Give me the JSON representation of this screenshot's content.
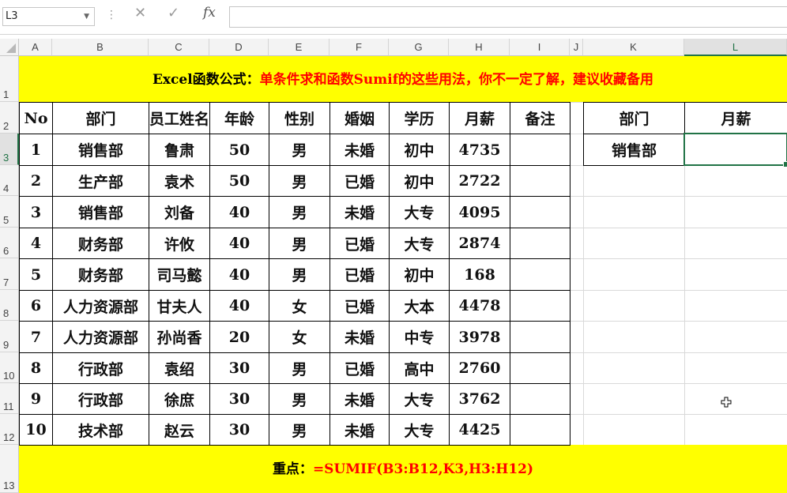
{
  "formula_bar": {
    "name_box": "L3",
    "formula": ""
  },
  "columns": [
    "A",
    "B",
    "C",
    "D",
    "E",
    "F",
    "G",
    "H",
    "I",
    "J",
    "K",
    "L"
  ],
  "rows": [
    "1",
    "2",
    "3",
    "4",
    "5",
    "6",
    "7",
    "8",
    "9",
    "10",
    "11",
    "12",
    "13"
  ],
  "banner_top": {
    "prefix": "Excel函数公式：",
    "main": "单条件求和函数Sumif的这些用法，你不一定了解，建议收藏备用"
  },
  "banner_bottom": {
    "prefix": "重点：",
    "formula": "=SUMIF(B3:B12,K3,H3:H12)"
  },
  "table": {
    "headers": [
      "No",
      "部门",
      "员工姓名",
      "年龄",
      "性别",
      "婚姻",
      "学历",
      "月薪",
      "备注"
    ],
    "rows": [
      [
        "1",
        "销售部",
        "鲁肃",
        "50",
        "男",
        "未婚",
        "初中",
        "4735",
        ""
      ],
      [
        "2",
        "生产部",
        "袁术",
        "50",
        "男",
        "已婚",
        "初中",
        "2722",
        ""
      ],
      [
        "3",
        "销售部",
        "刘备",
        "40",
        "男",
        "未婚",
        "大专",
        "4095",
        ""
      ],
      [
        "4",
        "财务部",
        "许攸",
        "40",
        "男",
        "已婚",
        "大专",
        "2874",
        ""
      ],
      [
        "5",
        "财务部",
        "司马懿",
        "40",
        "男",
        "已婚",
        "初中",
        "168",
        ""
      ],
      [
        "6",
        "人力资源部",
        "甘夫人",
        "40",
        "女",
        "已婚",
        "大本",
        "4478",
        ""
      ],
      [
        "7",
        "人力资源部",
        "孙尚香",
        "20",
        "女",
        "未婚",
        "中专",
        "3978",
        ""
      ],
      [
        "8",
        "行政部",
        "袁绍",
        "30",
        "男",
        "已婚",
        "高中",
        "2760",
        ""
      ],
      [
        "9",
        "行政部",
        "徐庶",
        "30",
        "男",
        "未婚",
        "大专",
        "3762",
        ""
      ],
      [
        "10",
        "技术部",
        "赵云",
        "30",
        "男",
        "未婚",
        "大专",
        "4425",
        ""
      ]
    ]
  },
  "lookup": {
    "headers": [
      "部门",
      "月薪"
    ],
    "dept": "销售部",
    "result": ""
  },
  "colors": {
    "banner": "#ffff00",
    "accent_red": "#ff0000",
    "excel_green": "#217346"
  }
}
